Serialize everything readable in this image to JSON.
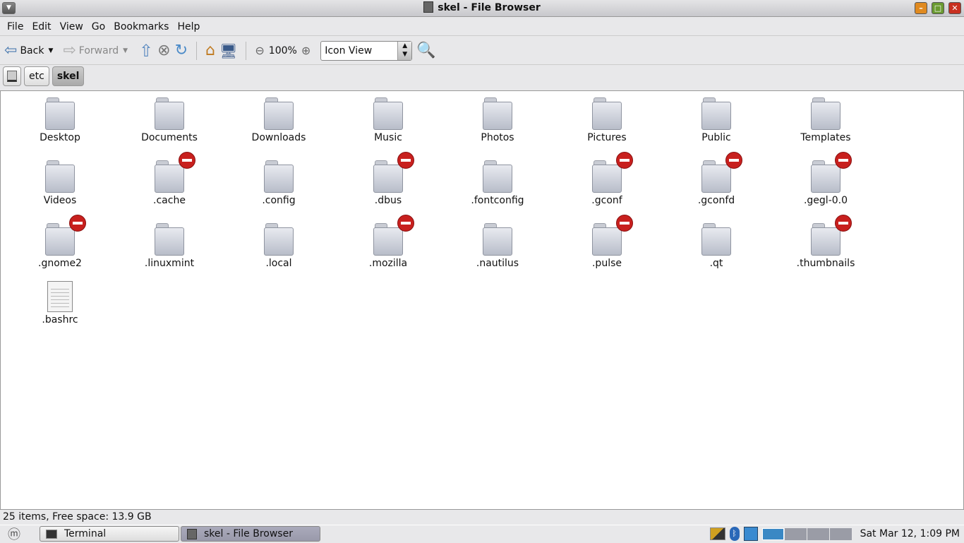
{
  "window": {
    "title": "skel - File Browser"
  },
  "menu": [
    "File",
    "Edit",
    "View",
    "Go",
    "Bookmarks",
    "Help"
  ],
  "toolbar": {
    "back": "Back",
    "forward": "Forward",
    "zoom": "100%",
    "view_mode": "Icon View"
  },
  "path": [
    "etc",
    "skel"
  ],
  "items": [
    {
      "name": "Desktop",
      "type": "folder",
      "locked": false
    },
    {
      "name": "Documents",
      "type": "folder",
      "locked": false
    },
    {
      "name": "Downloads",
      "type": "folder",
      "locked": false
    },
    {
      "name": "Music",
      "type": "folder",
      "locked": false
    },
    {
      "name": "Photos",
      "type": "folder",
      "locked": false
    },
    {
      "name": "Pictures",
      "type": "folder",
      "locked": false
    },
    {
      "name": "Public",
      "type": "folder",
      "locked": false
    },
    {
      "name": "Templates",
      "type": "folder",
      "locked": false
    },
    {
      "name": "Videos",
      "type": "folder",
      "locked": false
    },
    {
      "name": ".cache",
      "type": "folder",
      "locked": true
    },
    {
      "name": ".config",
      "type": "folder",
      "locked": false
    },
    {
      "name": ".dbus",
      "type": "folder",
      "locked": true
    },
    {
      "name": ".fontconfig",
      "type": "folder",
      "locked": false
    },
    {
      "name": ".gconf",
      "type": "folder",
      "locked": true
    },
    {
      "name": ".gconfd",
      "type": "folder",
      "locked": true
    },
    {
      "name": ".gegl-0.0",
      "type": "folder",
      "locked": true
    },
    {
      "name": ".gnome2",
      "type": "folder",
      "locked": true
    },
    {
      "name": ".linuxmint",
      "type": "folder",
      "locked": false
    },
    {
      "name": ".local",
      "type": "folder",
      "locked": false
    },
    {
      "name": ".mozilla",
      "type": "folder",
      "locked": true
    },
    {
      "name": ".nautilus",
      "type": "folder",
      "locked": false
    },
    {
      "name": ".pulse",
      "type": "folder",
      "locked": true
    },
    {
      "name": ".qt",
      "type": "folder",
      "locked": false
    },
    {
      "name": ".thumbnails",
      "type": "folder",
      "locked": true
    },
    {
      "name": ".bashrc",
      "type": "file",
      "locked": false
    }
  ],
  "status": "25 items, Free space: 13.9 GB",
  "taskbar": {
    "tasks": [
      "Terminal",
      "skel - File Browser"
    ],
    "clock": "Sat Mar 12,  1:09 PM"
  }
}
